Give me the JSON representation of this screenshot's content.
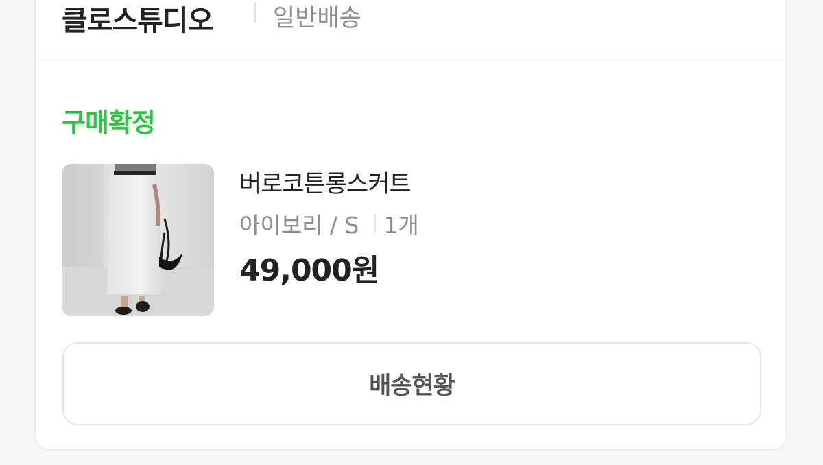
{
  "order": {
    "seller_name": "클로스튜디오",
    "shipping_type": "일반배송",
    "status_label": "구매확정",
    "product": {
      "name": "버로코튼롱스커트",
      "option": "아이보리 / S",
      "quantity": "1개",
      "price": "49,000원",
      "thumbnail": "white-long-skirt-photo"
    },
    "track_button_label": "배송현황"
  },
  "colors": {
    "status_green": "#2ec443",
    "text_primary": "#222222",
    "text_secondary": "#8c8c91",
    "border": "#e6e6e8"
  }
}
